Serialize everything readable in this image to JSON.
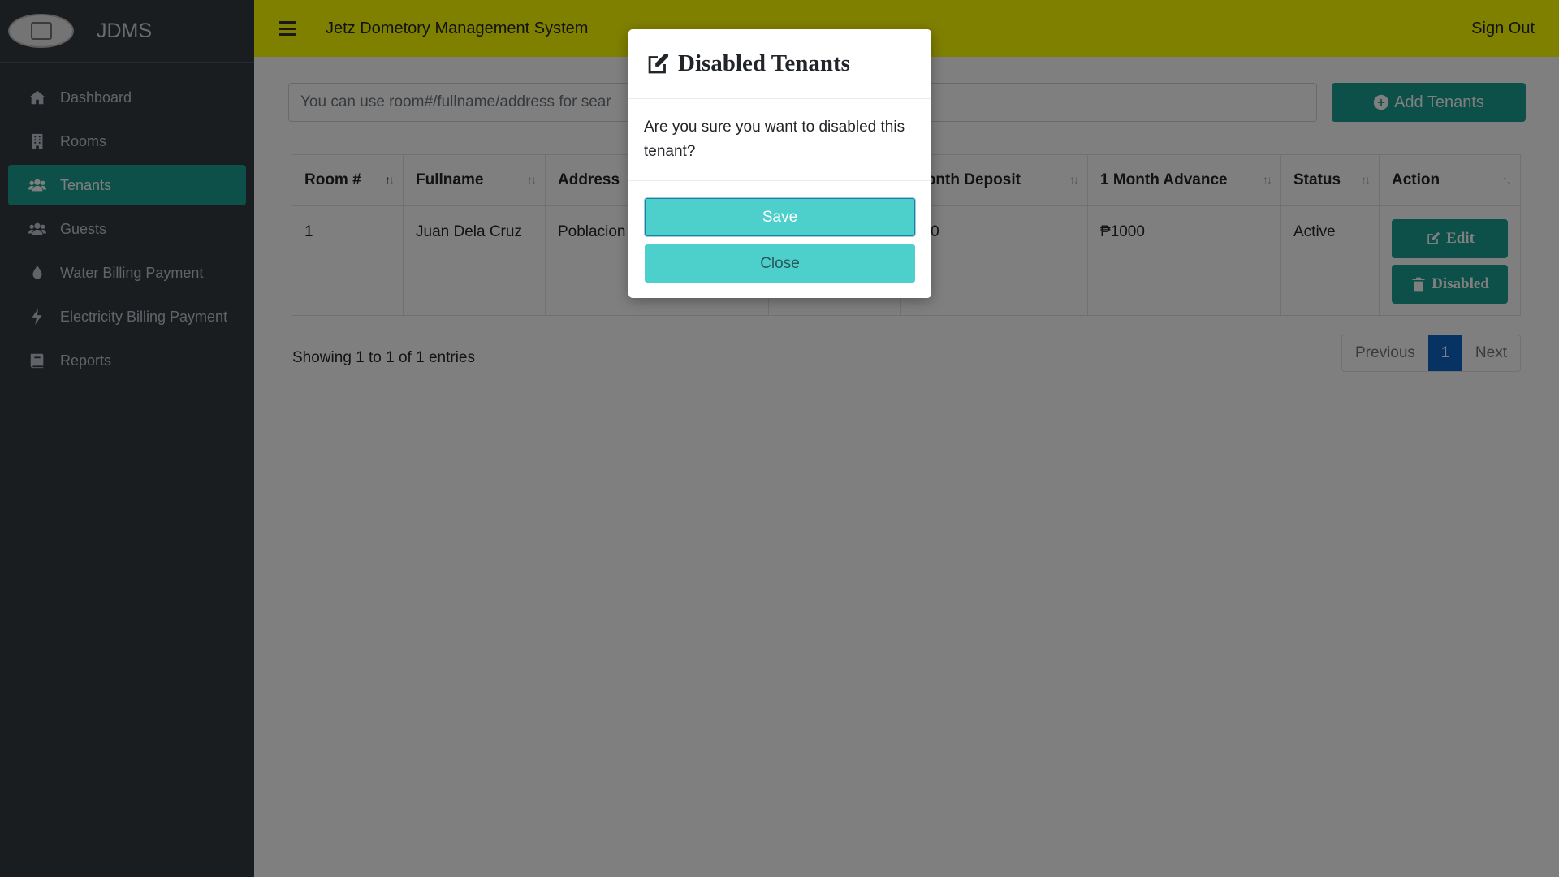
{
  "brand": {
    "name": "JDMS"
  },
  "sidebar": {
    "items": [
      {
        "label": "Dashboard",
        "icon": "home-icon",
        "active": false
      },
      {
        "label": "Rooms",
        "icon": "building-icon",
        "active": false
      },
      {
        "label": "Tenants",
        "icon": "users-icon",
        "active": true
      },
      {
        "label": "Guests",
        "icon": "users-icon",
        "active": false
      },
      {
        "label": "Water Billing Payment",
        "icon": "water-drop-icon",
        "active": false
      },
      {
        "label": "Electricity Billing Payment",
        "icon": "bolt-icon",
        "active": false
      },
      {
        "label": "Reports",
        "icon": "book-icon",
        "active": false
      }
    ]
  },
  "header": {
    "title": "Jetz Dometory Management System",
    "signout": "Sign Out",
    "color": "#ffff00"
  },
  "search": {
    "placeholder": "You can use room#/fullname/address for sear"
  },
  "toolbar": {
    "add_label": "Add Tenants",
    "accent": "#1aa193"
  },
  "table": {
    "headers": [
      "Room #",
      "Fullname",
      "Address",
      "",
      "Month Deposit",
      "1 Month Advance",
      "Status",
      "Action"
    ],
    "rows": [
      {
        "room": "1",
        "fullname": "Juan Dela Cruz",
        "address": "Poblacion",
        "col4": "",
        "deposit": "000",
        "advance": "₱1000",
        "status": "Active"
      }
    ],
    "edit_label": "Edit",
    "disable_label": "Disabled"
  },
  "footer": {
    "showing": "Showing 1 to 1 of 1 entries",
    "prev": "Previous",
    "page": "1",
    "next": "Next"
  },
  "modal": {
    "title": "Disabled Tenants",
    "message": "Are you sure you want to disabled this tenant?",
    "save_label": "Save",
    "close_label": "Close",
    "button_color": "#4dcfcb"
  }
}
